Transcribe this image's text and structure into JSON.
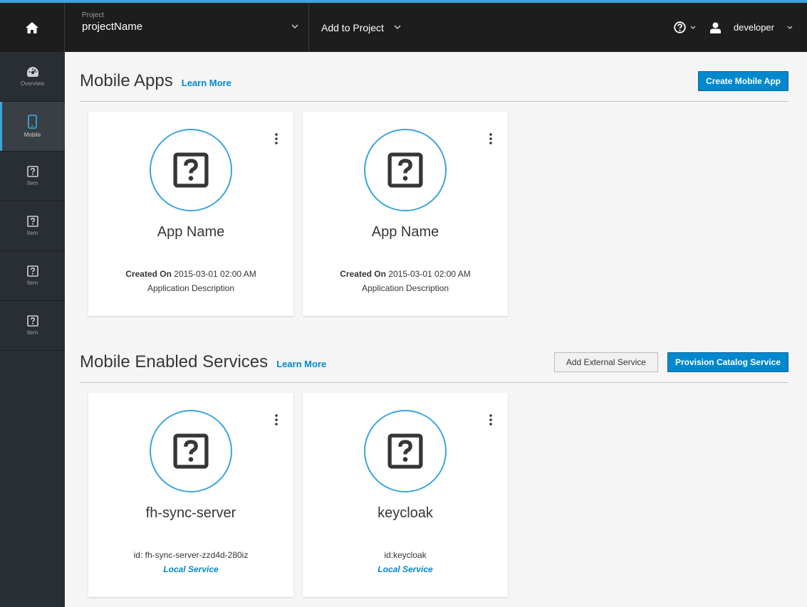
{
  "topbar": {
    "project_label": "Project",
    "project_name": "projectName",
    "add_to_project": "Add to Project",
    "user_name": "developer"
  },
  "sidebar": {
    "items": [
      {
        "label": "Overview",
        "icon": "dashboard-icon",
        "active": false
      },
      {
        "label": "Mobile",
        "icon": "mobile-icon",
        "active": true
      },
      {
        "label": "Item",
        "icon": "question-icon",
        "active": false
      },
      {
        "label": "Item",
        "icon": "question-icon",
        "active": false
      },
      {
        "label": "Item",
        "icon": "question-icon",
        "active": false
      },
      {
        "label": "Item",
        "icon": "question-icon",
        "active": false
      }
    ]
  },
  "mobile_apps": {
    "title": "Mobile Apps",
    "learn_more": "Learn More",
    "create_button": "Create Mobile App",
    "cards": [
      {
        "name": "App Name",
        "created_label": "Created On",
        "created_value": "2015-03-01 02:00 AM",
        "description": "Application Description"
      },
      {
        "name": "App Name",
        "created_label": "Created On",
        "created_value": "2015-03-01 02:00 AM",
        "description": "Application Description"
      }
    ]
  },
  "services": {
    "title": "Mobile Enabled Services",
    "learn_more": "Learn More",
    "add_external_button": "Add External Service",
    "provision_button": "Provision Catalog Service",
    "cards": [
      {
        "name": "fh-sync-server",
        "id": "id: fh-sync-server-zzd4d-280iz",
        "type": "Local Service"
      },
      {
        "name": "keycloak",
        "id": "id:keycloak",
        "type": "Local Service"
      }
    ]
  },
  "colors": {
    "accent": "#39a5dc",
    "primary_button": "#0088ce",
    "topbar": "#1d1d1d",
    "sidebar": "#292e34"
  }
}
